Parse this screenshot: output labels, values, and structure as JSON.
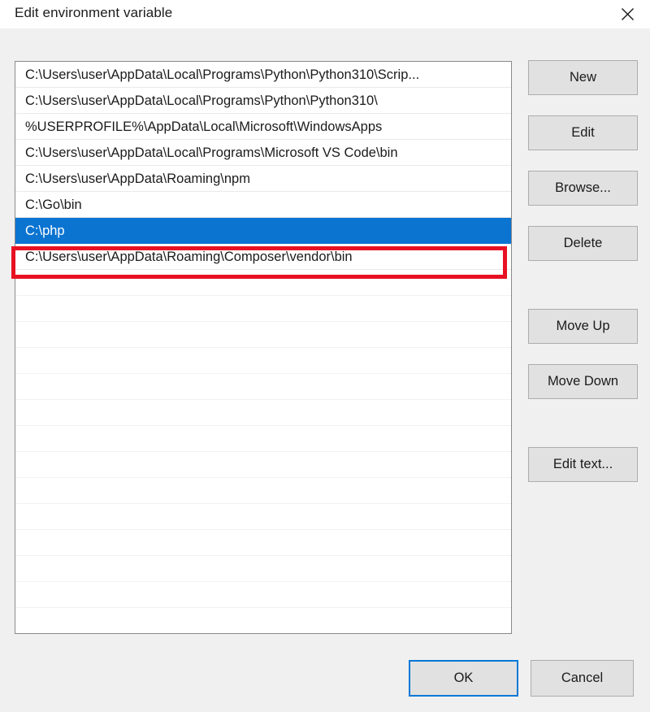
{
  "window": {
    "title": "Edit environment variable",
    "close_icon": "close-icon"
  },
  "list": {
    "entries": [
      "C:\\Users\\user\\AppData\\Local\\Programs\\Python\\Python310\\Scrip...",
      "C:\\Users\\user\\AppData\\Local\\Programs\\Python\\Python310\\",
      "%USERPROFILE%\\AppData\\Local\\Microsoft\\WindowsApps",
      "C:\\Users\\user\\AppData\\Local\\Programs\\Microsoft VS Code\\bin",
      "C:\\Users\\user\\AppData\\Roaming\\npm",
      "C:\\Go\\bin",
      "C:\\php",
      "C:\\Users\\user\\AppData\\Roaming\\Composer\\vendor\\bin"
    ],
    "selected_index": 6,
    "selected_value": "C:\\php",
    "empty_row_count": 13
  },
  "annotation": {
    "type": "highlight-rectangle",
    "color": "#e81123",
    "target": "C:\\php"
  },
  "side_buttons": {
    "new": "New",
    "edit": "Edit",
    "browse": "Browse...",
    "delete": "Delete",
    "move_up": "Move Up",
    "move_down": "Move Down",
    "edit_text": "Edit text..."
  },
  "footer": {
    "ok": "OK",
    "cancel": "Cancel"
  },
  "colors": {
    "selection_blue": "#0b74d1",
    "focus_blue": "#0078d7",
    "annotation_red": "#e81123",
    "dialog_background": "#f0f0f0",
    "button_face": "#e1e1e1"
  }
}
